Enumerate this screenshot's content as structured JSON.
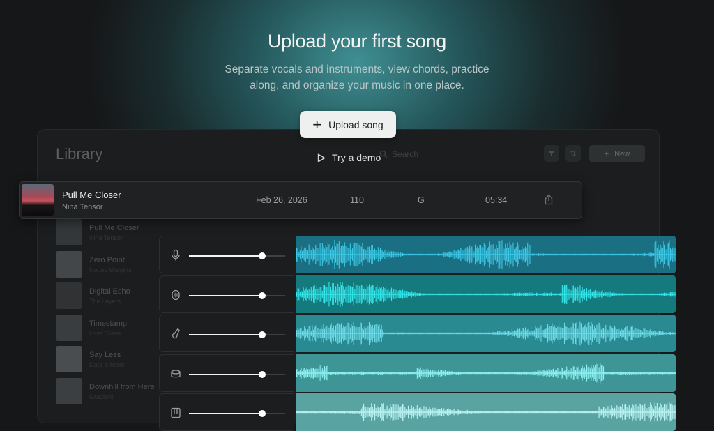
{
  "hero": {
    "title": "Upload your first song",
    "subtitle_line1": "Separate vocals and instruments, view chords, practice",
    "subtitle_line2": "along, and organize your music in one place.",
    "upload_label": "Upload song",
    "demo_label": "Try a demo"
  },
  "library": {
    "title": "Library",
    "search_placeholder": "Search",
    "new_label": "New"
  },
  "song": {
    "title": "Pull Me Closer",
    "artist": "Nina Tensor",
    "date": "Feb 26, 2026",
    "bpm": "110",
    "key": "G",
    "duration": "05:34"
  },
  "background_songs": [
    {
      "title": "Pull Me Closer",
      "artist": "Nina Tensor"
    },
    {
      "title": "Zero Point",
      "artist": "Nodes Weights"
    },
    {
      "title": "Digital Echo",
      "artist": "The Layers"
    },
    {
      "title": "Timestamp",
      "artist": "Loss Curve"
    },
    {
      "title": "Say Less",
      "artist": "Data Stream"
    },
    {
      "title": "Downhill from Here",
      "artist": "Gradient"
    }
  ],
  "tracks": [
    {
      "icon": "microphone-icon",
      "volume": 0.76,
      "color": "#3cc8e6",
      "bg": "#1b6f82"
    },
    {
      "icon": "vocals-icon",
      "volume": 0.76,
      "color": "#34e6ea",
      "bg": "#147a7e"
    },
    {
      "icon": "guitar-icon",
      "volume": 0.76,
      "color": "#6fdcea",
      "bg": "#2a8a92"
    },
    {
      "icon": "drum-icon",
      "volume": 0.76,
      "color": "#8ef0f2",
      "bg": "#3d9595"
    },
    {
      "icon": "piano-icon",
      "volume": 0.76,
      "color": "#b8f2f2",
      "bg": "#5aa3a3"
    }
  ]
}
